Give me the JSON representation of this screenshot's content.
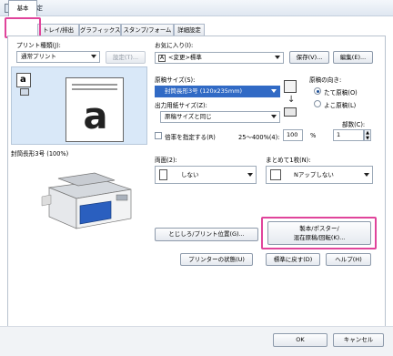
{
  "window": {
    "title": "印刷設定"
  },
  "tabs": [
    {
      "label": "基本"
    },
    {
      "label": "トレイ/排出"
    },
    {
      "label": "グラフィックス"
    },
    {
      "label": "スタンプ/フォーム"
    },
    {
      "label": "詳細設定"
    }
  ],
  "left": {
    "print_type_label": "プリント種類(J):",
    "print_type_value": "通常プリント",
    "settings_button": "設定(T)...",
    "preview_caption": "封筒長形3号 (100%)"
  },
  "favorites": {
    "label": "お気に入り(I):",
    "value": "<変更>標準",
    "save_button": "保存(V)...",
    "edit_button": "編集(E)..."
  },
  "paper": {
    "original_size_label": "原稿サイズ(S):",
    "original_size_value": "封筒長形3号 (120x235mm)",
    "output_size_label": "出力用紙サイズ(Z):",
    "output_size_value": "原稿サイズと同じ",
    "scale_label": "倍率を指定する(R)",
    "scale_range": "25〜400%(4):",
    "scale_value": "100",
    "scale_unit": "%"
  },
  "orientation": {
    "label": "原稿の向き:",
    "options": [
      "たて原稿(O)",
      "よこ原稿(L)"
    ],
    "selected": "たて原稿(O)"
  },
  "copies": {
    "label": "部数(C):",
    "value": "1"
  },
  "duplex": {
    "label": "両面(2):",
    "value": "しない"
  },
  "nup": {
    "label": "まとめて1枚(N):",
    "value": "Nアップしない"
  },
  "buttons": {
    "binding": "とじしろ/プリント位置(G)...",
    "booklet_line1": "製本/ポスター/",
    "booklet_line2": "混在原稿/回転(K)...",
    "printer_status": "プリンターの状態(U)",
    "restore_default": "標準に戻す(D)",
    "help": "ヘルプ(H)",
    "ok": "OK",
    "cancel": "キャンセル"
  },
  "colors": {
    "highlight": "#e0449b",
    "selection": "#316ac5"
  }
}
